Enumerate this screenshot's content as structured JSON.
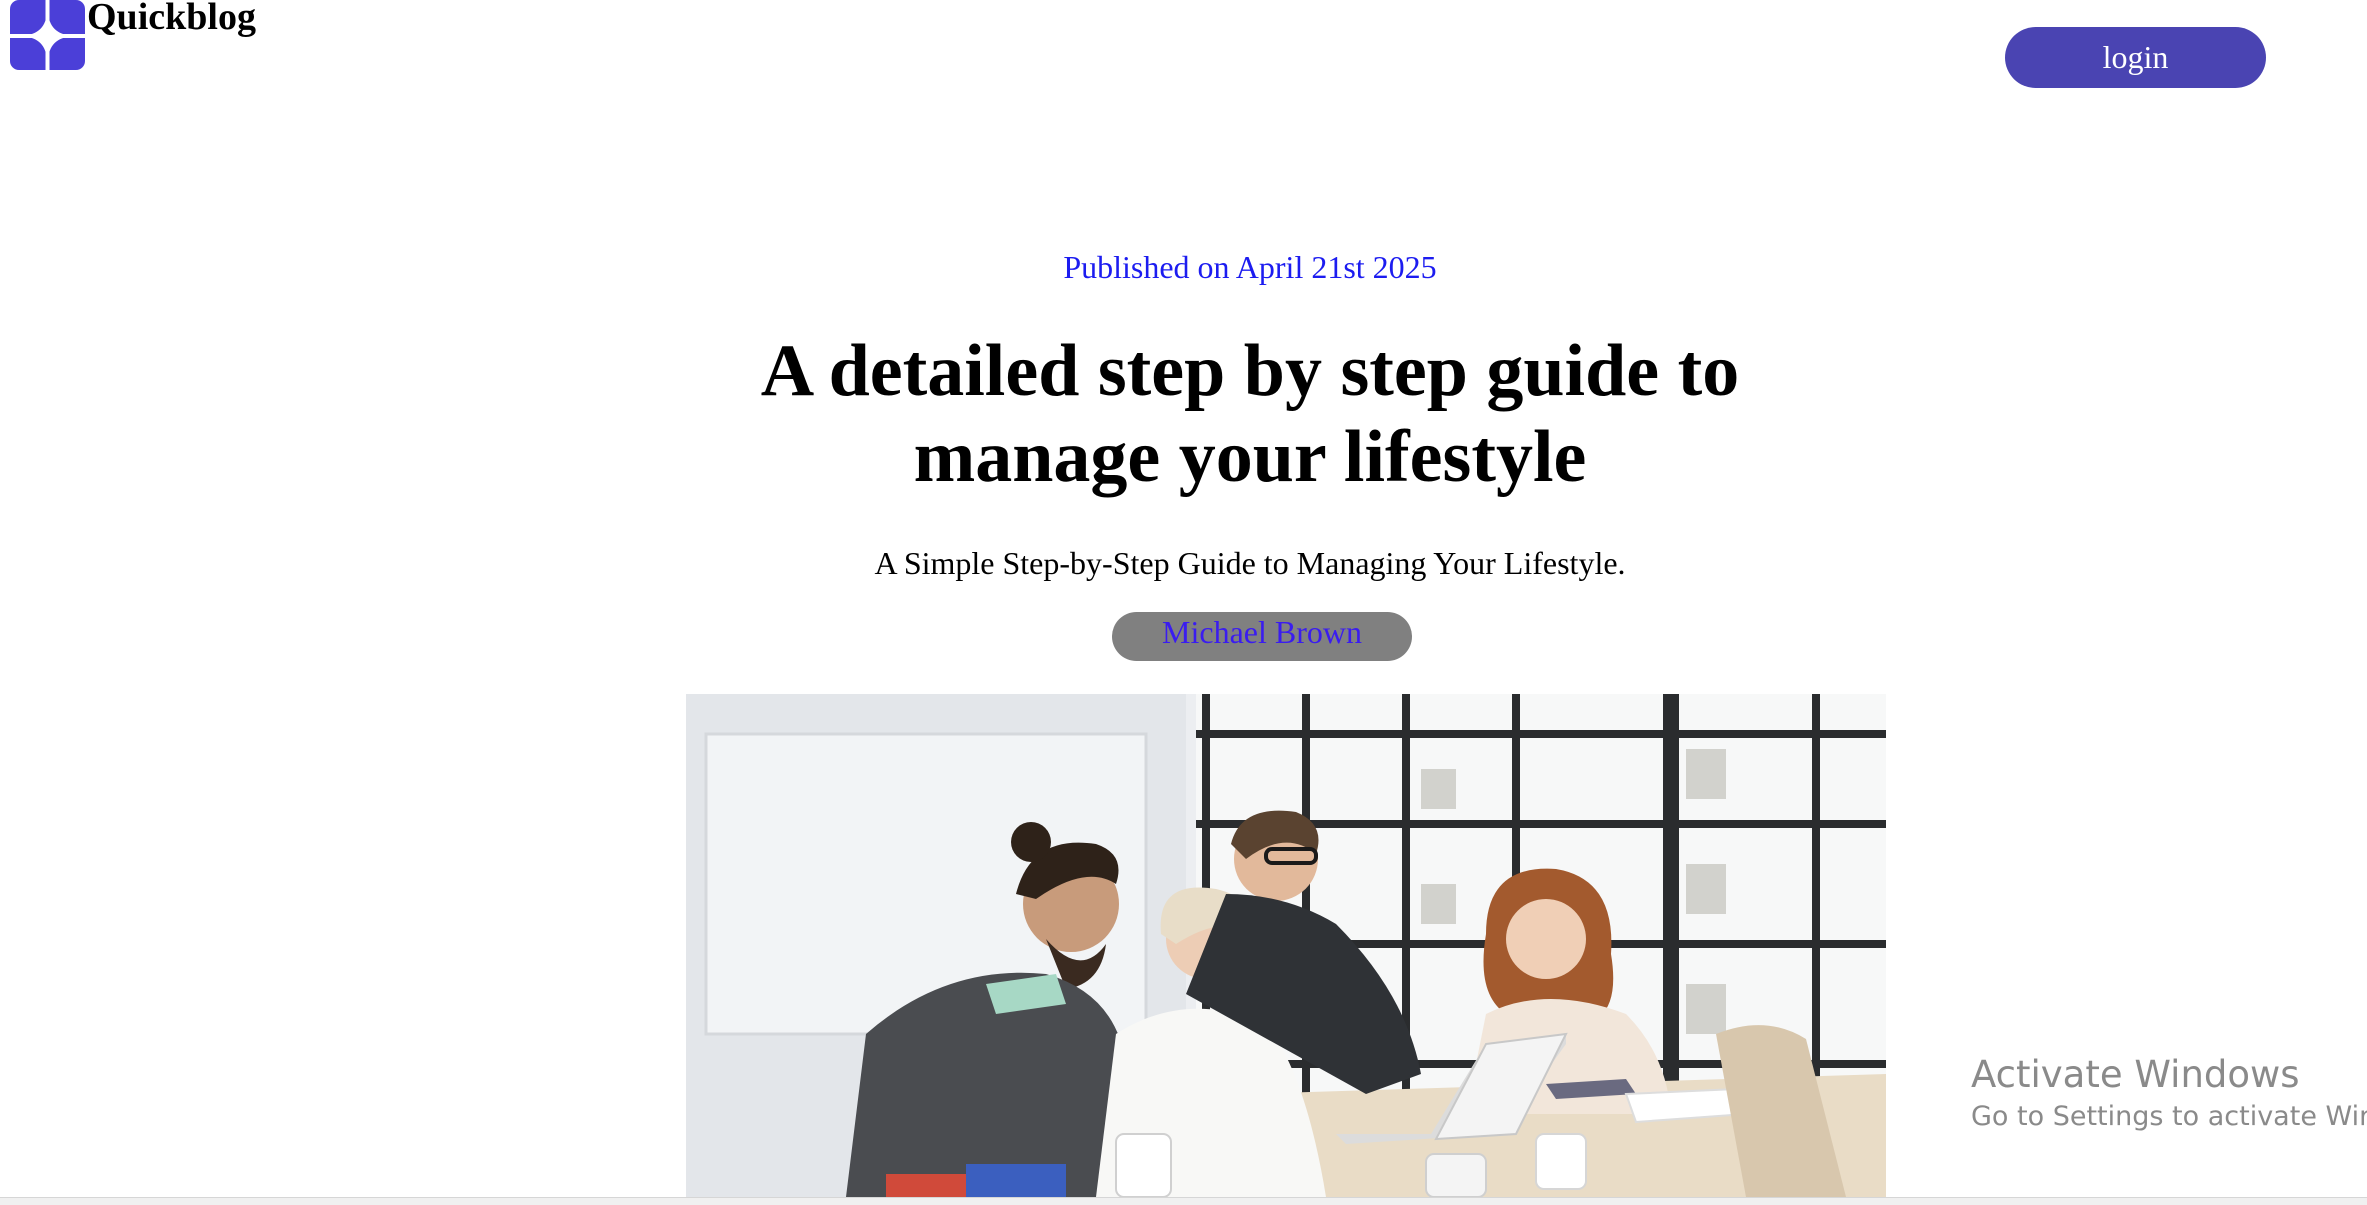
{
  "header": {
    "brand": "Quickblog",
    "logo_icon": "sparkle-icon",
    "login_label": "login",
    "accent_color": "#4a44b2"
  },
  "article": {
    "published": "Published on April 21st 2025",
    "title": "A detailed step by step guide to manage your lifestyle",
    "subtitle": "A Simple Step-by-Step Guide to Managing Your Lifestyle.",
    "author": "Michael Brown",
    "hero_image": "team-meeting-photo"
  },
  "watermark": {
    "title": "Activate Windows",
    "subtitle": "Go to Settings to activate Windows."
  }
}
